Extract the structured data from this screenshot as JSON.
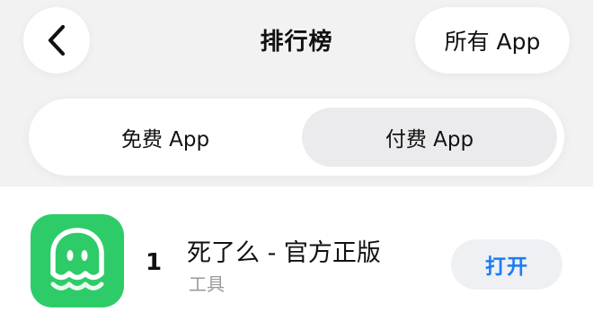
{
  "nav": {
    "title": "排行榜",
    "all_apps_label": "所有 App"
  },
  "segments": {
    "free_label": "免费 App",
    "paid_label": "付费 App",
    "selected": "paid"
  },
  "list": {
    "items": [
      {
        "rank": "1",
        "name": "死了么 - 官方正版",
        "category": "工具",
        "action_label": "打开",
        "icon": "ghost-icon",
        "icon_color": "#2ecc68"
      }
    ]
  },
  "colors": {
    "accent": "#1d7cf2",
    "app_icon_bg": "#2ecc68",
    "background": "#f2f2f3"
  }
}
